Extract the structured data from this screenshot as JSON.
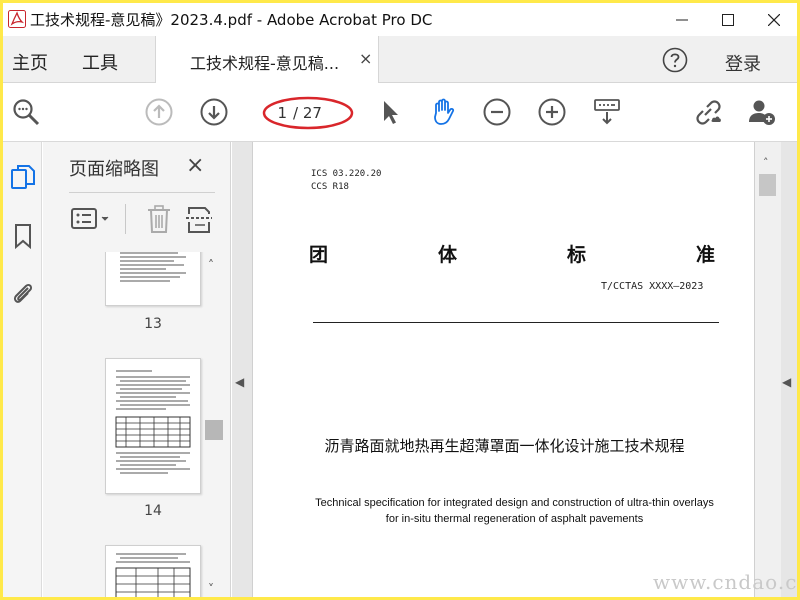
{
  "window": {
    "title": "工技术规程-意见稿》2023.4.pdf - Adobe Acrobat Pro DC",
    "controls": [
      "minimize",
      "maximize",
      "close"
    ]
  },
  "menu_tabs": {
    "home": "主页",
    "tools": "工具",
    "document_tab": "工技术规程-意见稿...",
    "document_tab_close": "×",
    "login": "登录"
  },
  "toolbar": {
    "icons": [
      "zoom-search-icon",
      "page-up-icon",
      "page-down-icon",
      "select-cursor-icon",
      "hand-tool-icon",
      "zoom-out-icon",
      "zoom-in-icon",
      "keyboard-scroll-icon",
      "share-link-icon",
      "add-user-icon"
    ],
    "page_current": "1",
    "page_total": "/ 27",
    "highlight_color": "#d9262b",
    "hand_tool_color": "#1473e6"
  },
  "sidebar_rail": {
    "icons": [
      "pages-icon",
      "bookmark-icon",
      "attachment-icon"
    ],
    "active_color": "#1473e6"
  },
  "thumbnails": {
    "title": "页面缩略图",
    "close": "×",
    "pages": [
      {
        "label": "13"
      },
      {
        "label": "14"
      },
      {
        "label": ""
      }
    ]
  },
  "document": {
    "ics": "ICS  03.220.20",
    "ccs": "CCS  R18",
    "heading_chars": [
      "团",
      "体",
      "标",
      "准"
    ],
    "standard_number": "T/CCTAS XXXX—2023",
    "title_cn": "沥青路面就地热再生超薄罩面一体化设计施工技术规程",
    "title_en_line1": "Technical specification for integrated design and construction of ultra-thin overlays",
    "title_en_line2": "for in-situ thermal regeneration of asphalt pavements"
  },
  "watermark": "www.cndao.com"
}
